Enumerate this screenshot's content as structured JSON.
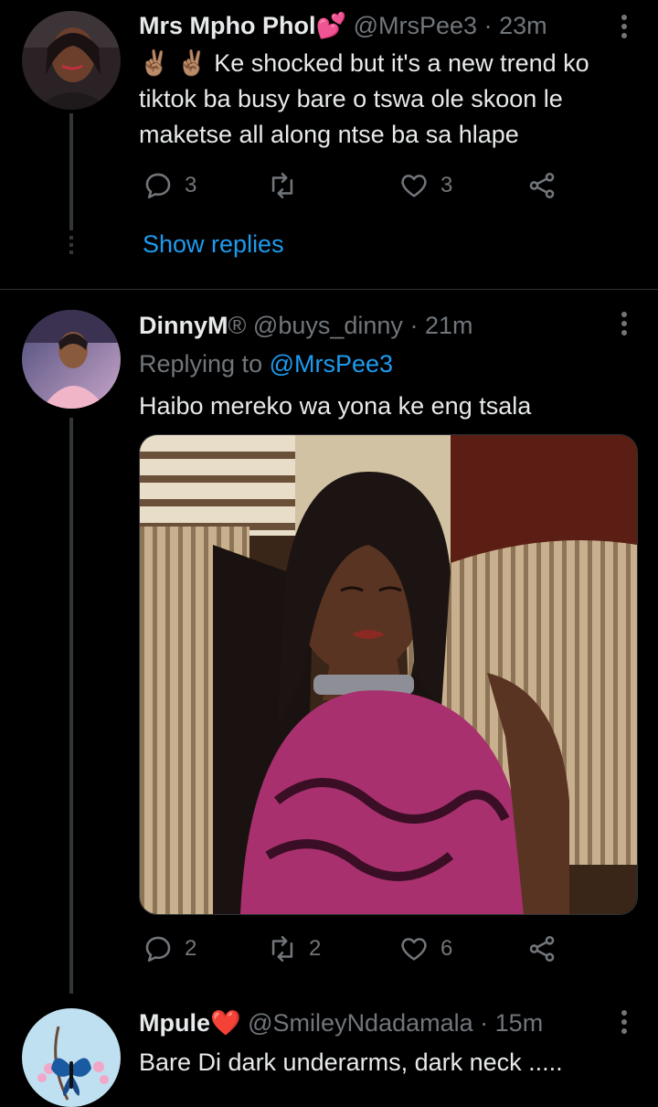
{
  "tweets": [
    {
      "name": "Mrs Mpho Phol",
      "name_emoji": "💕",
      "handle": "@MrsPee3",
      "time": "· 23m",
      "text": "✌🏽 ✌🏽 Ke shocked but it's a new trend ko tiktok ba busy bare o tswa ole skoon le maketse all along ntse ba sa hlape",
      "replies": "3",
      "retweets": "",
      "likes": "3",
      "show_replies": "Show replies"
    },
    {
      "name": "DinnyM",
      "name_emoji": "®",
      "handle": "@buys_dinny",
      "time": "· 21m",
      "replying_prefix": "Replying to ",
      "replying_to": "@MrsPee3",
      "text": "Haibo mereko wa yona ke eng tsala",
      "replies": "2",
      "retweets": "2",
      "likes": "6"
    },
    {
      "name": "Mpule",
      "name_emoji": "❤️",
      "handle": "@SmileyNdadamala",
      "time": "· 15m",
      "text": "Bare Di dark underarms, dark neck ....."
    }
  ],
  "icons": {
    "reply": "reply-icon",
    "retweet": "retweet-icon",
    "like": "heart-icon",
    "share": "share-icon",
    "more": "more-options-icon"
  },
  "colors": {
    "background": "#000000",
    "text": "#e7e9ea",
    "secondary": "#71767b",
    "link": "#1d9bf0",
    "divider": "#2f3336"
  }
}
